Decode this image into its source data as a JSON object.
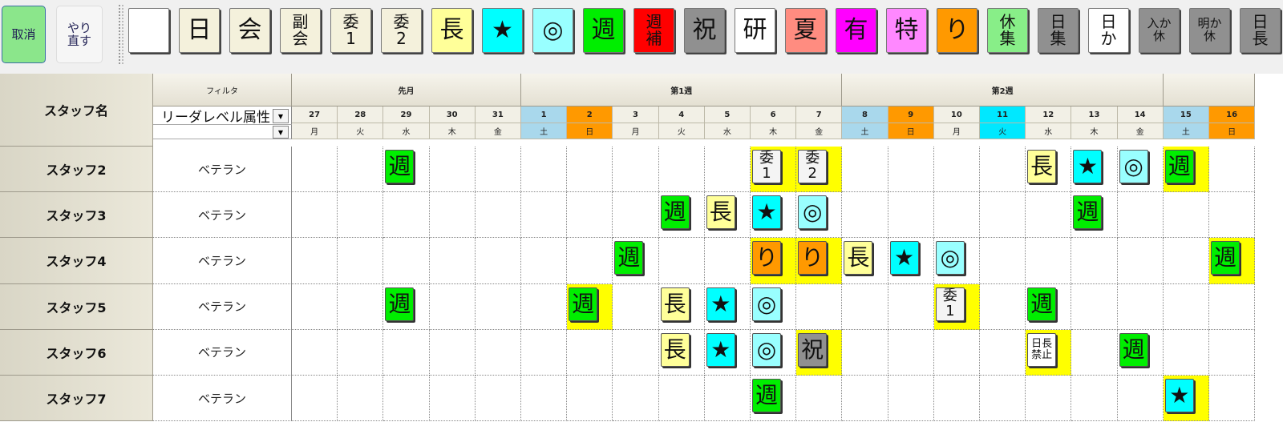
{
  "toolbar": {
    "undo_label": "取消",
    "redo_label": "やり直す",
    "tools": [
      {
        "label": "",
        "bg": "#ffffff"
      },
      {
        "label": "日",
        "bg": "#f4f1dc"
      },
      {
        "label": "会",
        "bg": "#f4f1dc"
      },
      {
        "label": "副会",
        "bg": "#f4f1dc"
      },
      {
        "label": "委1",
        "bg": "#f4f1dc"
      },
      {
        "label": "委2",
        "bg": "#f4f1dc"
      },
      {
        "label": "長",
        "bg": "#ffff99"
      },
      {
        "label": "★",
        "bg": "#00ffff"
      },
      {
        "label": "◎",
        "bg": "#99ffff"
      },
      {
        "label": "週",
        "bg": "#00ee00"
      },
      {
        "label": "週補",
        "bg": "#ff0000"
      },
      {
        "label": "祝",
        "bg": "#909090"
      },
      {
        "label": "研",
        "bg": "#ffffff"
      },
      {
        "label": "夏",
        "bg": "#ff8c80"
      },
      {
        "label": "有",
        "bg": "#ff00ff"
      },
      {
        "label": "特",
        "bg": "#ff88ff"
      },
      {
        "label": "り",
        "bg": "#ff9900"
      },
      {
        "label": "休集",
        "bg": "#88ee88"
      },
      {
        "label": "日集",
        "bg": "#909090"
      },
      {
        "label": "日か",
        "bg": "#ffffff"
      },
      {
        "label": "入か休",
        "bg": "#909090"
      },
      {
        "label": "明か休",
        "bg": "#909090"
      },
      {
        "label": "日長",
        "bg": "#909090"
      }
    ]
  },
  "grid": {
    "header_staff": "スタッフ名",
    "header_filter": "フィルタ",
    "filter_value": "リーダレベル属性",
    "filter2_value": "",
    "weeks": [
      {
        "label": "先月",
        "span": 5
      },
      {
        "label": "第1週",
        "span": 7
      },
      {
        "label": "第2週",
        "span": 7
      },
      {
        "label": "",
        "span": 2
      }
    ],
    "days": [
      {
        "d": "27",
        "w": "月",
        "c": ""
      },
      {
        "d": "28",
        "w": "火",
        "c": ""
      },
      {
        "d": "29",
        "w": "水",
        "c": ""
      },
      {
        "d": "30",
        "w": "木",
        "c": ""
      },
      {
        "d": "31",
        "w": "金",
        "c": ""
      },
      {
        "d": "1",
        "w": "土",
        "c": "sat"
      },
      {
        "d": "2",
        "w": "日",
        "c": "sun"
      },
      {
        "d": "3",
        "w": "月",
        "c": ""
      },
      {
        "d": "4",
        "w": "火",
        "c": ""
      },
      {
        "d": "5",
        "w": "水",
        "c": ""
      },
      {
        "d": "6",
        "w": "木",
        "c": ""
      },
      {
        "d": "7",
        "w": "金",
        "c": ""
      },
      {
        "d": "8",
        "w": "土",
        "c": "sat"
      },
      {
        "d": "9",
        "w": "日",
        "c": "sun"
      },
      {
        "d": "10",
        "w": "月",
        "c": ""
      },
      {
        "d": "11",
        "w": "火",
        "c": "hol"
      },
      {
        "d": "12",
        "w": "水",
        "c": ""
      },
      {
        "d": "13",
        "w": "木",
        "c": ""
      },
      {
        "d": "14",
        "w": "金",
        "c": ""
      },
      {
        "d": "15",
        "w": "土",
        "c": "sat"
      },
      {
        "d": "16",
        "w": "日",
        "c": "sun"
      }
    ],
    "rows": [
      {
        "name": "スタッフ2",
        "attr": "ベテラン",
        "shifts": [
          {
            "col": 2,
            "label": "週",
            "bg": "#00ee00"
          },
          {
            "col": 10,
            "label": "委1",
            "bg": "#f4f4f4",
            "hl": true
          },
          {
            "col": 11,
            "label": "委2",
            "bg": "#f4f4f4",
            "hl": true
          },
          {
            "col": 16,
            "label": "長",
            "bg": "#ffff99"
          },
          {
            "col": 17,
            "label": "★",
            "bg": "#00ffff"
          },
          {
            "col": 18,
            "label": "◎",
            "bg": "#99ffff"
          },
          {
            "col": 19,
            "label": "週",
            "bg": "#00ee00",
            "hl": true
          }
        ]
      },
      {
        "name": "スタッフ3",
        "attr": "ベテラン",
        "shifts": [
          {
            "col": 8,
            "label": "週",
            "bg": "#00ee00"
          },
          {
            "col": 9,
            "label": "長",
            "bg": "#ffff99"
          },
          {
            "col": 10,
            "label": "★",
            "bg": "#00ffff"
          },
          {
            "col": 11,
            "label": "◎",
            "bg": "#99ffff"
          },
          {
            "col": 17,
            "label": "週",
            "bg": "#00ee00"
          }
        ]
      },
      {
        "name": "スタッフ4",
        "attr": "ベテラン",
        "shifts": [
          {
            "col": 7,
            "label": "週",
            "bg": "#00ee00"
          },
          {
            "col": 10,
            "label": "り",
            "bg": "#ff9900",
            "hl": true
          },
          {
            "col": 11,
            "label": "り",
            "bg": "#ff9900",
            "hl": true
          },
          {
            "col": 12,
            "label": "長",
            "bg": "#ffff99"
          },
          {
            "col": 13,
            "label": "★",
            "bg": "#00ffff"
          },
          {
            "col": 14,
            "label": "◎",
            "bg": "#99ffff"
          },
          {
            "col": 20,
            "label": "週",
            "bg": "#00ee00",
            "hl": true
          }
        ]
      },
      {
        "name": "スタッフ5",
        "attr": "ベテラン",
        "shifts": [
          {
            "col": 2,
            "label": "週",
            "bg": "#00ee00"
          },
          {
            "col": 6,
            "label": "週",
            "bg": "#00ee00",
            "hl": true
          },
          {
            "col": 8,
            "label": "長",
            "bg": "#ffff99"
          },
          {
            "col": 9,
            "label": "★",
            "bg": "#00ffff"
          },
          {
            "col": 10,
            "label": "◎",
            "bg": "#99ffff"
          },
          {
            "col": 14,
            "label": "委1",
            "bg": "#f4f4f4",
            "hl": true
          },
          {
            "col": 16,
            "label": "週",
            "bg": "#00ee00"
          }
        ]
      },
      {
        "name": "スタッフ6",
        "attr": "ベテラン",
        "shifts": [
          {
            "col": 8,
            "label": "長",
            "bg": "#ffff99"
          },
          {
            "col": 9,
            "label": "★",
            "bg": "#00ffff"
          },
          {
            "col": 10,
            "label": "◎",
            "bg": "#99ffff"
          },
          {
            "col": 11,
            "label": "祝",
            "bg": "#909090",
            "hl": true
          },
          {
            "col": 16,
            "label": "日長禁止",
            "bg": "#ffffff",
            "hl": true
          },
          {
            "col": 18,
            "label": "週",
            "bg": "#00ee00"
          }
        ]
      },
      {
        "name": "スタッフ7",
        "attr": "ベテラン",
        "shifts": [
          {
            "col": 10,
            "label": "週",
            "bg": "#00ee00"
          },
          {
            "col": 19,
            "label": "★",
            "bg": "#00ffff",
            "hl": true
          }
        ]
      }
    ]
  }
}
